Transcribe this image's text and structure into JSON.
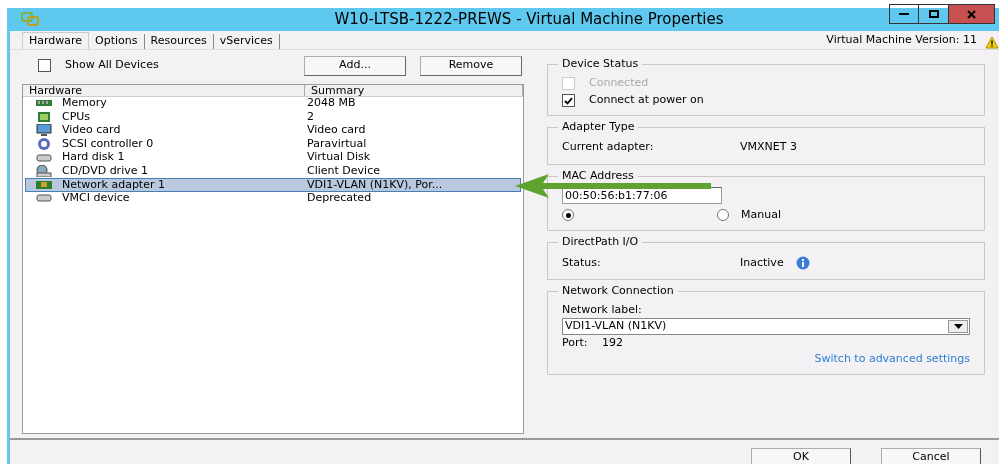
{
  "window": {
    "title": "W10-LTSB-1222-PREWS - Virtual Machine Properties"
  },
  "tabs": [
    {
      "label": "Hardware",
      "selected": true
    },
    {
      "label": "Options",
      "selected": false
    },
    {
      "label": "Resources",
      "selected": false
    },
    {
      "label": "vServices",
      "selected": false
    }
  ],
  "version": "Virtual Machine Version: 11",
  "show_all_devices": {
    "label": "Show All Devices",
    "checked": false
  },
  "toolbar_buttons": [
    "Add...",
    "Remove"
  ],
  "hardware_table": {
    "columns": [
      "Hardware",
      "Summary"
    ],
    "rows": [
      {
        "kind": "memory",
        "name": "Memory",
        "summary": "2048 MB",
        "selected": false
      },
      {
        "kind": "cpu",
        "name": "CPUs",
        "summary": "2",
        "selected": false
      },
      {
        "kind": "video",
        "name": "Video card",
        "summary": "Video card",
        "selected": false
      },
      {
        "kind": "scsi",
        "name": "SCSI controller 0",
        "summary": "Paravirtual",
        "selected": false
      },
      {
        "kind": "disk",
        "name": "Hard disk 1",
        "summary": "Virtual Disk",
        "selected": false
      },
      {
        "kind": "cd",
        "name": "CD/DVD drive 1",
        "summary": "Client Device",
        "selected": false
      },
      {
        "kind": "nic",
        "name": "Network adapter 1",
        "summary": "VDI1-VLAN (N1KV), Por...",
        "selected": true
      },
      {
        "kind": "disk",
        "name": "VMCI device",
        "summary": "Deprecated",
        "selected": false
      }
    ]
  },
  "device_status": {
    "title": "Device Status",
    "options": [
      {
        "label": "Connected",
        "checked": false,
        "disabled": true
      },
      {
        "label": "Connect at power on",
        "checked": true,
        "disabled": false
      }
    ]
  },
  "adapter_type": {
    "title": "Adapter Type",
    "label": "Current adapter:",
    "value": "VMXNET 3"
  },
  "mac_address": {
    "title": "MAC Address",
    "value": "00:50:56:b1:77:06",
    "modes": [
      {
        "selected": true
      },
      {
        "label": "Manual",
        "selected": false
      }
    ]
  },
  "directpath": {
    "title": "DirectPath I/O",
    "label": "Status:",
    "value": "Inactive"
  },
  "network_connection": {
    "title": "Network Connection",
    "label": "Network label:",
    "value": "VDI1-VLAN (N1KV)",
    "port_label": "Port:",
    "port": "192",
    "link": "Switch to advanced settings"
  },
  "footer_buttons": [
    "OK",
    "Cancel"
  ]
}
